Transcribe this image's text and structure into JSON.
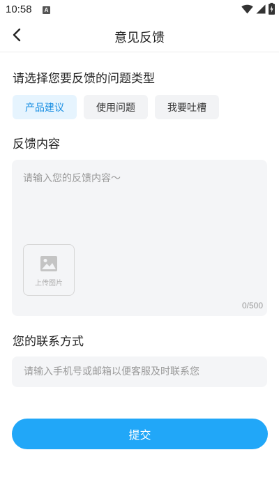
{
  "status_bar": {
    "time": "10:58",
    "notification_badge": "A",
    "icons": [
      "wifi-icon",
      "signal-icon",
      "battery-charging-icon"
    ]
  },
  "nav": {
    "title": "意见反馈",
    "back_icon": "chevron-left-icon"
  },
  "feedback_type": {
    "label": "请选择您要反馈的问题类型",
    "options": [
      "产品建议",
      "使用问题",
      "我要吐槽"
    ],
    "selected": "产品建议"
  },
  "content": {
    "label": "反馈内容",
    "placeholder": "请输入您的反馈内容～",
    "value": "",
    "upload_label": "上传图片",
    "upload_icon": "image-icon",
    "char_count": "0/500"
  },
  "contact": {
    "label": "您的联系方式",
    "placeholder": "请输入手机号或邮箱以便客服及时联系您",
    "value": ""
  },
  "submit": {
    "label": "提交"
  },
  "colors": {
    "accent": "#21a7f8",
    "chip_active_bg": "#e6f4fe",
    "chip_active_text": "#1a8fe3",
    "field_bg": "#f4f5f7"
  }
}
